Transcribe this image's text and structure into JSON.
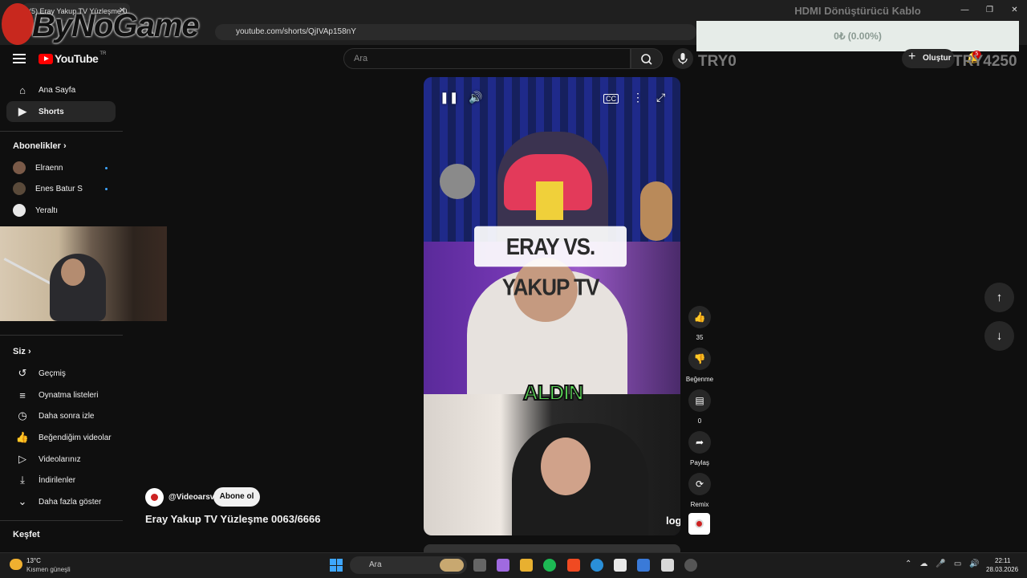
{
  "browser": {
    "tab_title": "(5) Eray Yakup TV Yüzleşme 0",
    "tab_close": "✕",
    "url": "youtube.com/shorts/QjIVAp158nY",
    "window_minimize": "—",
    "window_restore": "❐",
    "window_close": "✕"
  },
  "overlay": {
    "logo_text": "ByNoGame",
    "product_title": "HDMI Dönüştürücü Kablo",
    "price_text": "0₺ (0.00%)",
    "left_counter": "TRY0",
    "right_counter": "TRY4250"
  },
  "masthead": {
    "logo_word": "YouTube",
    "logo_country": "TR",
    "search_placeholder": "Ara",
    "create_label": "Oluştur",
    "notification_count": "5"
  },
  "sidebar": {
    "main": [
      {
        "label": "Ana Sayfa",
        "icon": "home-icon"
      },
      {
        "label": "Shorts",
        "icon": "shorts-icon",
        "active": true
      }
    ],
    "subscriptions_heading": "Abonelikler",
    "subscriptions": [
      {
        "label": "Elraenn",
        "new": true
      },
      {
        "label": "Enes Batur S",
        "new": true
      },
      {
        "label": "Yeraltı",
        "new": false
      }
    ],
    "you_heading": "Siz",
    "you": [
      {
        "label": "Geçmiş",
        "icon": "history-icon"
      },
      {
        "label": "Oynatma listeleri",
        "icon": "playlist-icon"
      },
      {
        "label": "Daha sonra izle",
        "icon": "clock-icon"
      },
      {
        "label": "Beğendiğim videolar",
        "icon": "like-icon"
      },
      {
        "label": "Videolarınız",
        "icon": "video-icon"
      },
      {
        "label": "İndirilenler",
        "icon": "download-icon"
      },
      {
        "label": "Daha fazla göster",
        "icon": "chevron-down-icon"
      }
    ],
    "explore_heading": "Keşfet"
  },
  "player": {
    "caption_top": "ERAY VS. YAKUP TV",
    "caption_bottom": "ALDIN",
    "watermark": "log"
  },
  "actions": {
    "like_count": "35",
    "dislike_label": "Beğenme",
    "comment_count": "0",
    "share_label": "Paylaş",
    "remix_label": "Remix"
  },
  "video": {
    "channel": "@Videoarsv",
    "subscribe_label": "Abone ol",
    "title": "Eray Yakup TV Yüzleşme 0063/6666"
  },
  "taskbar": {
    "temperature": "13°C",
    "weather": "Kısmen güneşli",
    "search_placeholder": "Ara",
    "time": "22:11",
    "date": "28.03.2026"
  },
  "colors": {
    "background": "#0f0f0f",
    "youtube_red": "#ff0000",
    "subscribe_bg": "#f1f1f1",
    "caption_green": "#5ee05a"
  }
}
